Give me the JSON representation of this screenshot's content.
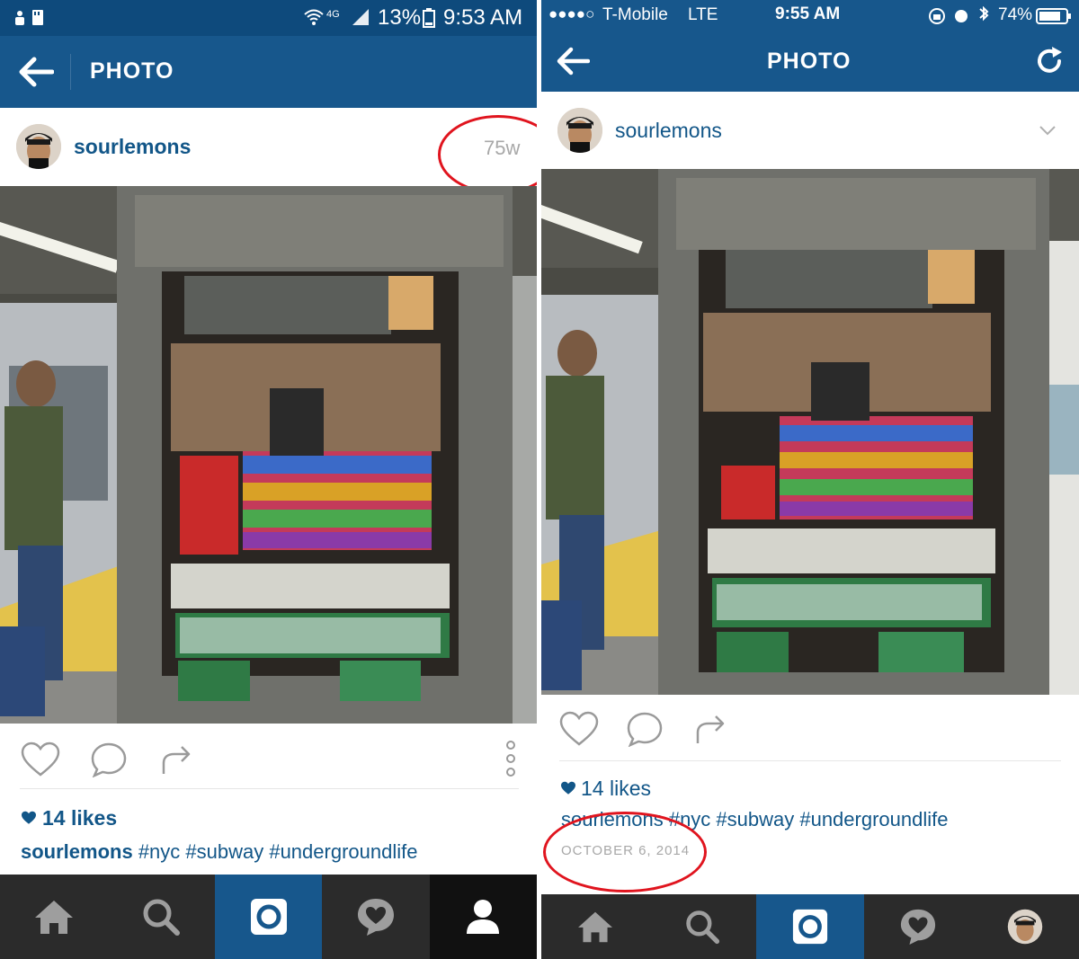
{
  "left": {
    "status": {
      "battery": "13%",
      "time": "9:53 AM",
      "network": "4G"
    },
    "nav": {
      "title": "PHOTO"
    },
    "post": {
      "username": "sourlemons",
      "time_ago": "75w"
    },
    "likes": "14 likes",
    "caption": {
      "username": "sourlemons",
      "tags": " #nyc #subway #undergroundlife"
    }
  },
  "right": {
    "status": {
      "signal": "●●●●○",
      "carrier": "T-Mobile",
      "network": "LTE",
      "time": "9:55 AM",
      "battery": "74%"
    },
    "nav": {
      "title": "PHOTO"
    },
    "post": {
      "username": "sourlemons"
    },
    "likes": "14 likes",
    "caption": {
      "username": "sourlemons",
      "tags": " #nyc #subway #undergroundlife"
    },
    "date": "OCTOBER 6, 2014"
  },
  "icons": {
    "back": "back-arrow-icon",
    "refresh": "refresh-icon",
    "heart": "heart-icon",
    "comment": "comment-icon",
    "share": "share-icon",
    "more": "more-options-icon",
    "chevron": "chevron-down-icon",
    "tabs": [
      "home-icon",
      "search-icon",
      "camera-icon",
      "activity-icon",
      "profile-icon"
    ]
  },
  "colors": {
    "brand": "#17578c",
    "status_bar": "#0e4a7c",
    "link": "#125688",
    "annotation": "#e0141e",
    "tabbar": "#2b2b2b"
  }
}
